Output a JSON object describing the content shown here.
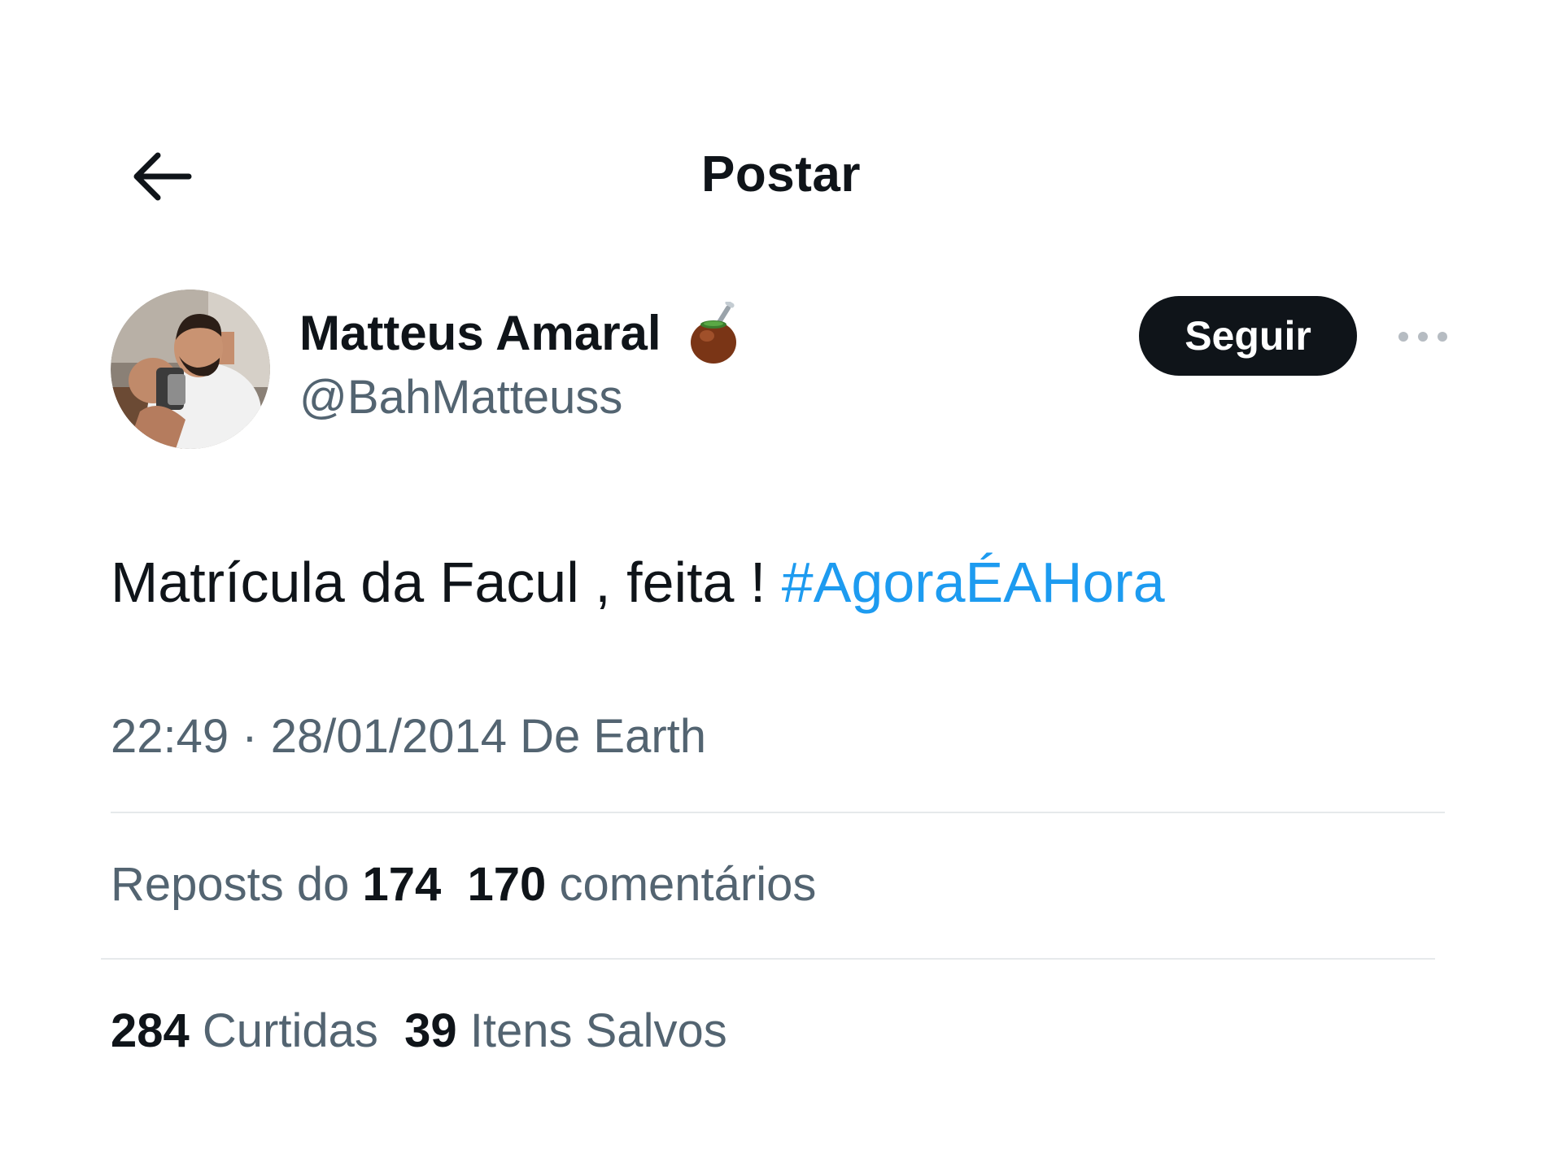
{
  "header": {
    "title": "Postar",
    "back_icon": "arrow-left-icon"
  },
  "author": {
    "display_name": "Matteus Amaral",
    "emoji_icon": "chimarrao-gourd-icon",
    "handle": "@BahMatteuss",
    "follow_label": "Seguir",
    "more_icon": "more-dots-icon"
  },
  "tweet": {
    "text": "Matrícula da Facul , feita ! ",
    "hashtag": "#AgoraÉAHora"
  },
  "meta": {
    "time": "22:49",
    "separator": "·",
    "date": "28/01/2014",
    "source": "De Earth"
  },
  "stats": {
    "reposts_label": "Reposts do",
    "reposts_count": "174",
    "comments_count": "170",
    "comments_label": "comentários",
    "likes_count": "284",
    "likes_label": "Curtidas",
    "saves_count": "39",
    "saves_label": "Itens Salvos"
  },
  "colors": {
    "text": "#0f1419",
    "secondary": "#536471",
    "link": "#1d9bf0",
    "button_bg": "#0f1419",
    "divider": "#e6e9eb"
  }
}
